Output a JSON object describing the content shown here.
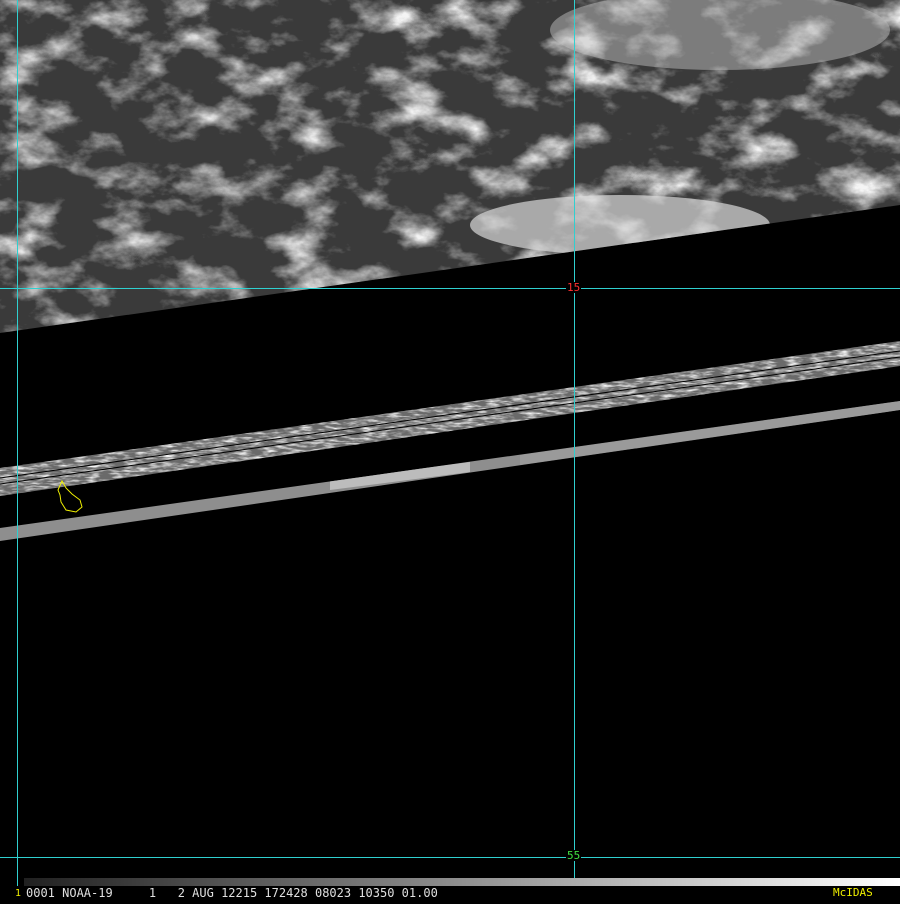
{
  "image": {
    "grid_labels": {
      "horizontal_upper": "15",
      "horizontal_lower": "55"
    },
    "frame_number": "1",
    "footer_line": "0001 NOAA-19     1   2 AUG 12215 172428 08023 10350 01.00",
    "brand": "McIDAS"
  },
  "colors": {
    "background": "#000000",
    "grid": "#2fd0d0",
    "label_upper": "#ff3030",
    "label_lower": "#40e040",
    "coast_outline": "#f0f000",
    "footer_text": "#e0e0e0",
    "brand_text": "#f0f000",
    "frame_number": "#f0f000"
  },
  "icons": [
    "coastline-outline"
  ]
}
